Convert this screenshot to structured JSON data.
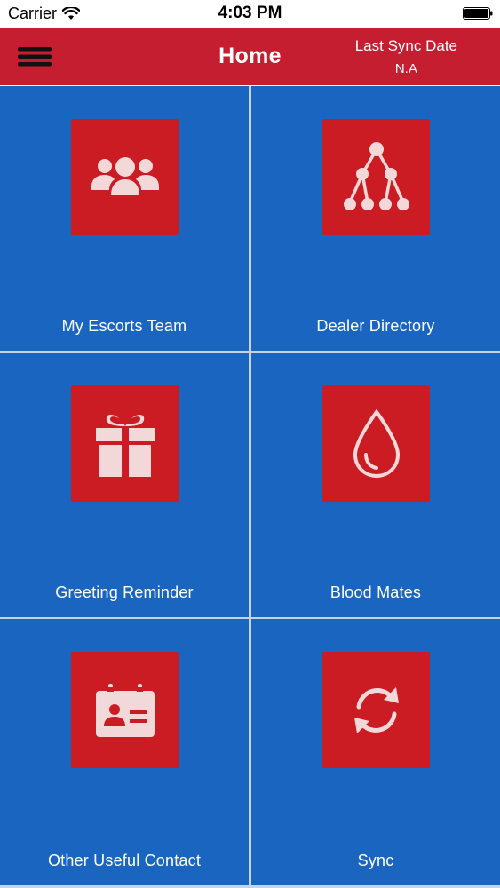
{
  "status_bar": {
    "carrier": "Carrier",
    "time": "4:03 PM"
  },
  "nav": {
    "title": "Home",
    "sync_label": "Last Sync Date",
    "sync_value": "N.A"
  },
  "tiles": [
    {
      "label": "My Escorts Team",
      "icon": "team-icon"
    },
    {
      "label": "Dealer Directory",
      "icon": "hierarchy-icon"
    },
    {
      "label": "Greeting Reminder",
      "icon": "gift-icon"
    },
    {
      "label": "Blood Mates",
      "icon": "blood-drop-icon"
    },
    {
      "label": "Other Useful Contact",
      "icon": "contact-card-icon"
    },
    {
      "label": "Sync",
      "icon": "sync-icon"
    }
  ],
  "colors": {
    "nav_background": "#c41e30",
    "tile_background": "#1a65c0",
    "icon_background": "#cb1b23",
    "icon_foreground": "#f3d8da"
  }
}
